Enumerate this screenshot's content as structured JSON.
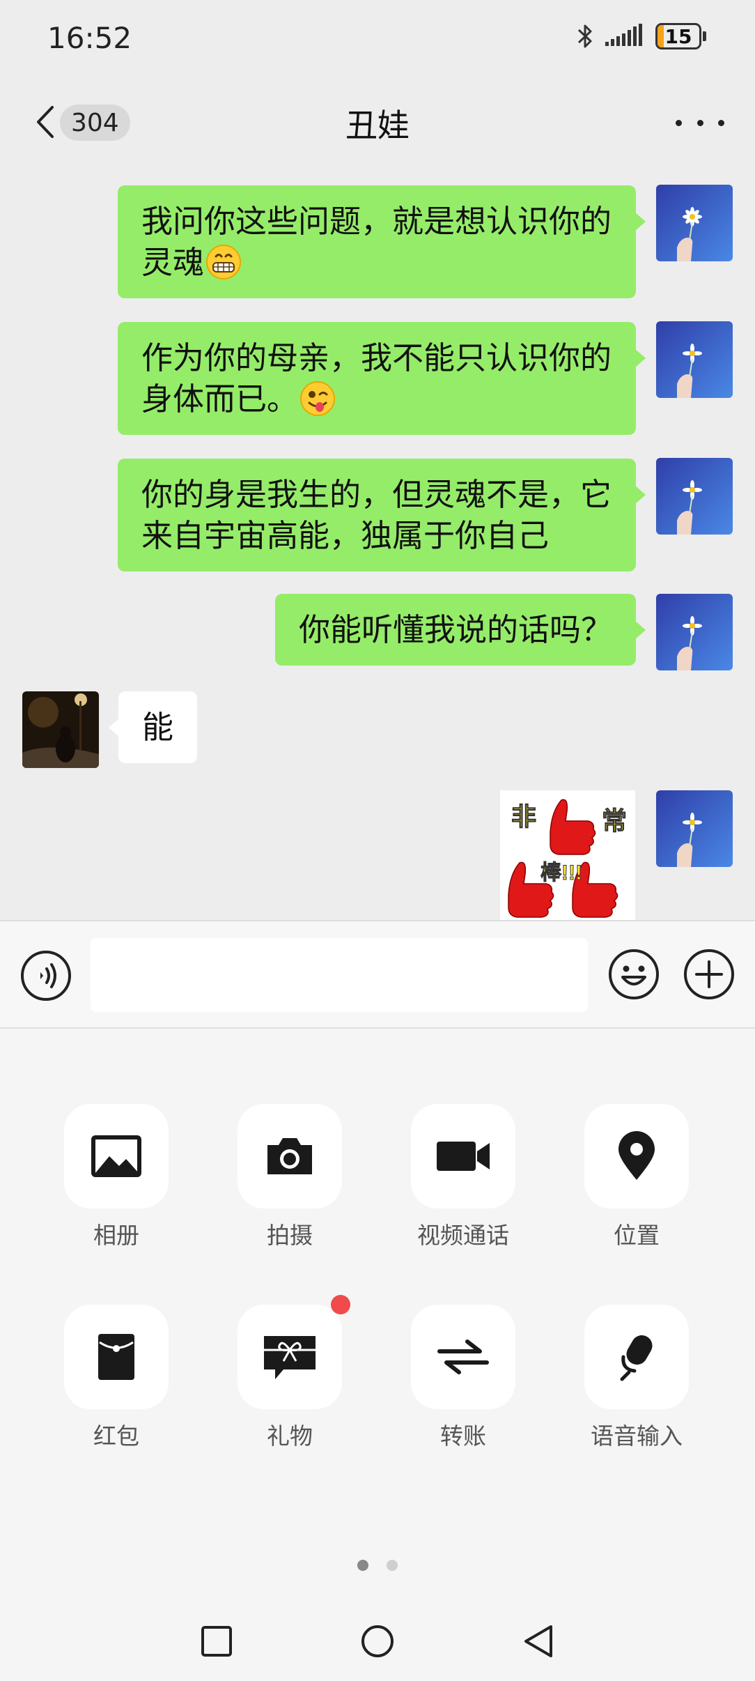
{
  "status_bar": {
    "time": "16:52",
    "battery_level": "15",
    "battery_fraction": 0.15,
    "icons": [
      "bluetooth-icon",
      "signal-icon",
      "battery-icon"
    ]
  },
  "header": {
    "unread_count": "304",
    "title": "丑娃",
    "icons": [
      "chevron-left-icon",
      "more-icon"
    ]
  },
  "messages": [
    {
      "sender": "self",
      "type": "text",
      "lines": [
        "我问你这些问题，就是想认识你的",
        "灵魂"
      ],
      "emoji": "grinning-face"
    },
    {
      "sender": "self",
      "type": "text",
      "lines": [
        "作为你的母亲，我不能只认识你的",
        "身体而已。"
      ],
      "emoji": "winking-tongue-face"
    },
    {
      "sender": "self",
      "type": "text",
      "lines": [
        "你的身是我生的，但灵魂不是，它",
        "来自宇宙高能，独属于你自己"
      ]
    },
    {
      "sender": "self",
      "type": "text",
      "lines": [
        "你能听懂我说的话吗？"
      ]
    },
    {
      "sender": "other",
      "type": "text",
      "lines": [
        "能"
      ]
    },
    {
      "sender": "self",
      "type": "sticker",
      "sticker_text": [
        "非",
        "常",
        "棒!!!"
      ]
    }
  ],
  "input": {
    "value": "",
    "icons": [
      "voice-icon",
      "emoji-icon",
      "plus-icon"
    ]
  },
  "tools": [
    {
      "label": "相册",
      "icon": "photo-album-icon"
    },
    {
      "label": "拍摄",
      "icon": "camera-icon"
    },
    {
      "label": "视频通话",
      "icon": "video-call-icon"
    },
    {
      "label": "位置",
      "icon": "location-icon"
    },
    {
      "label": "红包",
      "icon": "red-packet-icon"
    },
    {
      "label": "礼物",
      "icon": "gift-icon",
      "badge": true
    },
    {
      "label": "转账",
      "icon": "transfer-icon"
    },
    {
      "label": "语音输入",
      "icon": "voice-input-icon"
    }
  ],
  "pager": {
    "pages": 2,
    "active": 1
  },
  "colors": {
    "outgoing_bubble": "#95ec69",
    "incoming_bubble": "#ffffff",
    "background": "#ededed",
    "badge_red": "#f04a4a",
    "battery_low": "#f5a31a"
  },
  "nav_bar": {
    "icons": [
      "recent-apps-icon",
      "home-icon",
      "back-icon"
    ]
  }
}
